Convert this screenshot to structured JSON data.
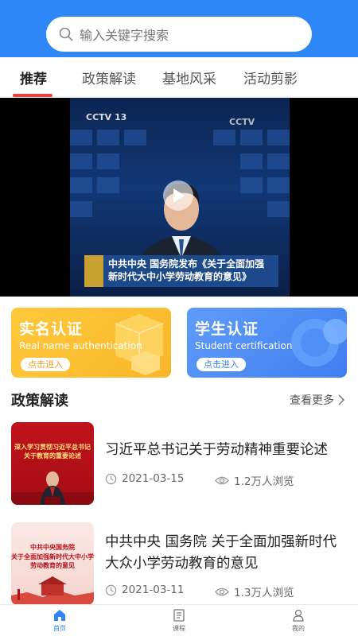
{
  "search": {
    "placeholder": "输入关键字搜索"
  },
  "tabs": [
    {
      "label": "推荐",
      "active": true
    },
    {
      "label": "政策解读",
      "active": false
    },
    {
      "label": "基地风采",
      "active": false
    },
    {
      "label": "活动剪影",
      "active": false
    }
  ],
  "video": {
    "channel": "CCTV 13",
    "caption_line1": "中共中央 国务院发布《关于全面加强",
    "caption_line2": "新时代大中小学劳动教育的意见》"
  },
  "auth_cards": {
    "real": {
      "title": "实名认证",
      "subtitle": "Real name authentication",
      "button": "点击进入",
      "color": "#f9b62a"
    },
    "student": {
      "title": "学生认证",
      "subtitle": "Student certification",
      "button": "点击进入",
      "color": "#3f7ef0"
    }
  },
  "policy_section": {
    "title": "政策解读",
    "more": "查看更多"
  },
  "news": [
    {
      "title": "习近平总书记关于劳动精神重要论述",
      "date": "2021-03-15",
      "views": "1.2万人浏览",
      "thumb_text_1": "深入学习贯彻习近平总书记",
      "thumb_text_2": "关于教育的重要论述"
    },
    {
      "title": "中共中央  国务院  关于全面加强新时代大众小学劳动教育的意见",
      "date": "2021-03-11",
      "views": "1.3万人浏览",
      "thumb_text_1": "中共中央国务院",
      "thumb_text_2": "关于全面加强新时代大中小学",
      "thumb_text_3": "劳动教育的意见"
    }
  ],
  "bottom_nav": [
    {
      "label": "首页",
      "icon": "home-icon",
      "active": true
    },
    {
      "label": "课程",
      "icon": "book-icon",
      "active": false
    },
    {
      "label": "我的",
      "icon": "profile-icon",
      "active": false
    }
  ],
  "colors": {
    "primary": "#2f86f6",
    "tab_indicator": "#f04040"
  }
}
